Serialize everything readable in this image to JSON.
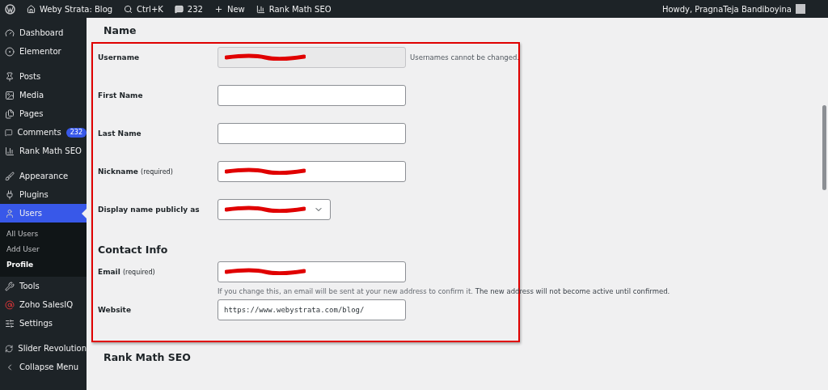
{
  "admin_bar": {
    "site": "Weby Strata: Blog",
    "search": "Ctrl+K",
    "comments": "232",
    "new": "New",
    "seo": "Rank Math SEO",
    "greeting": "Howdy, PragnaTeja Bandiboyina"
  },
  "sidebar": {
    "groups": [
      {
        "items": [
          {
            "label": "Dashboard",
            "selected": false
          },
          {
            "label": "Elementor",
            "selected": false
          }
        ]
      },
      {
        "items": [
          {
            "label": "Posts",
            "selected": false
          },
          {
            "label": "Media",
            "selected": false
          },
          {
            "label": "Pages",
            "selected": false
          },
          {
            "label": "Comments",
            "selected": false,
            "badge": "232"
          },
          {
            "label": "Rank Math SEO",
            "selected": false
          }
        ]
      },
      {
        "items": [
          {
            "label": "Appearance",
            "selected": false
          },
          {
            "label": "Plugins",
            "selected": false
          },
          {
            "label": "Users",
            "selected": true,
            "submenu": [
              {
                "label": "All Users",
                "selected": false
              },
              {
                "label": "Add User",
                "selected": false
              },
              {
                "label": "Profile",
                "selected": true
              }
            ]
          },
          {
            "label": "Tools",
            "selected": false
          },
          {
            "label": "Zoho SalesIQ",
            "selected": false
          },
          {
            "label": "Settings",
            "selected": false
          }
        ]
      },
      {
        "items": [
          {
            "label": "Slider Revolution",
            "selected": false
          },
          {
            "label": "Collapse Menu",
            "selected": false
          }
        ]
      }
    ]
  },
  "name_heading": "Name",
  "highlight_frame": true,
  "name_fields": [
    {
      "kind": "text",
      "label": "Username",
      "disabled": true,
      "redacted": true,
      "note": "Usernames cannot be changed."
    },
    {
      "kind": "text",
      "label": "First Name",
      "disabled": false,
      "redacted": false
    },
    {
      "kind": "text",
      "label": "Last Name",
      "disabled": false,
      "redacted": false
    },
    {
      "kind": "text",
      "label": "Nickname",
      "required": "(required)",
      "disabled": false,
      "redacted": true
    },
    {
      "kind": "select",
      "label": "Display name publicly as",
      "disabled": false,
      "redacted": true
    }
  ],
  "contact_heading": "Contact Info",
  "contact_fields": [
    {
      "label": "Email",
      "required": "(required)",
      "disabled": false,
      "redacted": true,
      "description": "If you change this, an email will be sent at your new address to confirm it. **The new address will not become active until confirmed.**"
    },
    {
      "label": "Website",
      "disabled": false,
      "redacted": false,
      "value": "https://www.webystrata.com/blog/"
    }
  ],
  "next_heading": "Rank Math SEO"
}
